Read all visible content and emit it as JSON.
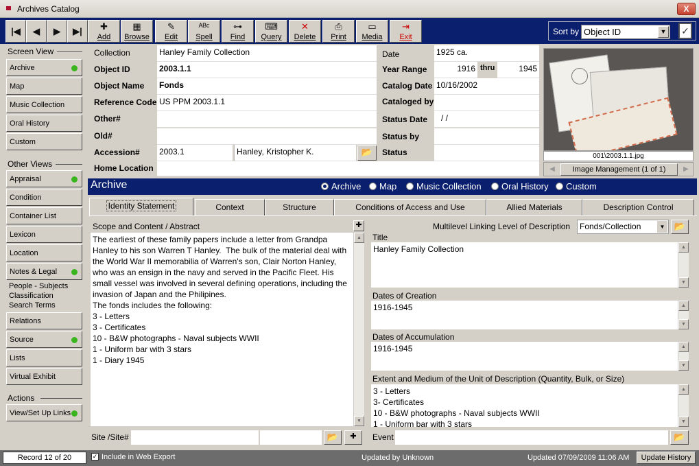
{
  "window": {
    "title": "Archives Catalog",
    "close_label": "X"
  },
  "toolbar": {
    "nav": [
      {
        "icon": "first-record-icon",
        "glyph": "|◀"
      },
      {
        "icon": "previous-record-icon",
        "glyph": "◀"
      },
      {
        "icon": "next-record-icon",
        "glyph": "▶"
      },
      {
        "icon": "last-record-icon",
        "glyph": "▶|"
      }
    ],
    "buttons": [
      {
        "label": "Add",
        "icon": "add-icon",
        "glyph": "✚"
      },
      {
        "label": "Browse",
        "icon": "browse-grid-icon",
        "glyph": "▦"
      },
      {
        "label": "Edit",
        "icon": "edit-document-icon",
        "glyph": "✎"
      },
      {
        "label": "Spell",
        "icon": "spell-check-icon",
        "glyph": "ᴬᴮᶜ"
      },
      {
        "label": "Find",
        "icon": "binoculars-icon",
        "glyph": "⊶"
      },
      {
        "label": "Query",
        "icon": "query-keyboard-icon",
        "glyph": "⌨"
      },
      {
        "label": "Delete",
        "icon": "delete-x-icon",
        "glyph": "✕"
      },
      {
        "label": "Print",
        "icon": "printer-icon",
        "glyph": "⎙"
      },
      {
        "label": "Media",
        "icon": "film-strip-icon",
        "glyph": "▭"
      },
      {
        "label": "Exit",
        "icon": "exit-door-icon",
        "glyph": "⇥"
      }
    ],
    "sort_label": "Sort by",
    "sort_value": "Object ID"
  },
  "sidebar": {
    "screen_view_header": "Screen View",
    "screen_view": [
      {
        "label": "Archive",
        "dot": true
      },
      {
        "label": "Map",
        "dot": false
      },
      {
        "label": "Music Collection",
        "dot": false
      },
      {
        "label": "Oral History",
        "dot": false
      },
      {
        "label": "Custom",
        "dot": false
      }
    ],
    "other_views_header": "Other Views",
    "other_views": [
      {
        "label": "Appraisal",
        "dot": true
      },
      {
        "label": "Condition",
        "dot": false
      },
      {
        "label": "Container List",
        "dot": false
      },
      {
        "label": "Lexicon",
        "dot": false
      },
      {
        "label": "Location",
        "dot": false
      },
      {
        "label": "Notes & Legal",
        "dot": true
      }
    ],
    "people_subjects": "People - Subjects",
    "classification": "Classification",
    "search_terms": "Search Terms",
    "other_views_2": [
      {
        "label": "Relations",
        "dot": false
      },
      {
        "label": "Source",
        "dot": true
      },
      {
        "label": "Lists",
        "dot": false
      },
      {
        "label": "Virtual Exhibit",
        "dot": false
      }
    ],
    "actions_header": "Actions",
    "actions": [
      {
        "label": "View/Set Up Links",
        "dot": true
      }
    ]
  },
  "form": {
    "collection_label": "Collection",
    "collection": "Hanley Family Collection",
    "object_id_label": "Object ID",
    "object_id": "2003.1.1",
    "object_name_label": "Object Name",
    "object_name": "Fonds",
    "reference_code_label": "Reference Code",
    "reference_code": "US PPM 2003.1.1",
    "other_label": "Other#",
    "other": "",
    "old_label": "Old#",
    "old": "",
    "accession_label": "Accession#",
    "accession": "2003.1",
    "accession_name": "Hanley, Kristopher K.",
    "home_location_label": "Home Location",
    "home_location": "",
    "date_label": "Date",
    "date": "1925 ca.",
    "year_range_label": "Year Range",
    "year_from": "1916",
    "thru": "thru",
    "year_to": "1945",
    "catalog_date_label": "Catalog Date",
    "catalog_date": "10/16/2002",
    "cataloged_by_label": "Cataloged by",
    "cataloged_by": "",
    "status_date_label": "Status Date",
    "status_date": "/ /",
    "status_by_label": "Status by",
    "status_by": "",
    "status_label": "Status",
    "status": ""
  },
  "image": {
    "caption": "001\\2003.1.1.jpg",
    "management": "Image Management (1 of 1)"
  },
  "section": {
    "title": "Archive",
    "radios": [
      {
        "label": "Archive",
        "on": true
      },
      {
        "label": "Map",
        "on": false
      },
      {
        "label": "Music Collection",
        "on": false
      },
      {
        "label": "Oral History",
        "on": false
      },
      {
        "label": "Custom",
        "on": false
      }
    ]
  },
  "tabs": [
    "Identity Statement",
    "Context",
    "Structure",
    "Conditions of Access and Use",
    "Allied Materials",
    "Description Control"
  ],
  "identity": {
    "scope_label": "Scope and Content / Abstract",
    "scope_text": "The earliest of these family papers include a letter from Grandpa Hanley to his son Warren T Hanley.  The bulk of the material deal with the World War II memorabilia of Warren's son, Clair Norton Hanley, who was an ensign in the navy and served in the Pacific Fleet. His small vessel was involved in several defining operations, including the invasion of Japan and the Philipines.\nThe fonds includes the following:\n3 - Letters\n3 - Certificates\n10 - B&W photographs - Naval subjects WWII\n1 - Uniform bar with 3 stars\n1 - Diary 1945",
    "level_label": "Multilevel Linking Level of Description",
    "level_value": "Fonds/Collection",
    "title_label": "Title",
    "title": "Hanley Family Collection",
    "creation_label": "Dates of Creation",
    "creation": "1916-1945",
    "accumulation_label": "Dates of  Accumulation",
    "accumulation": "1916-1945",
    "extent_label": "Extent and Medium of the Unit of Description (Quantity, Bulk, or Size)",
    "extent": "3 - Letters\n3- Certificates\n10 - B&W photographs - Naval subjects WWII\n1 - Uniform bar with 3 stars",
    "site_label": "Site /Site#",
    "event_label": "Event"
  },
  "statusbar": {
    "record": "Record 12 of 20",
    "web_export": "Include in Web Export",
    "updated_by": "Updated by  Unknown",
    "updated": "Updated    07/09/2009 11:06 AM",
    "update_history": "Update History"
  }
}
